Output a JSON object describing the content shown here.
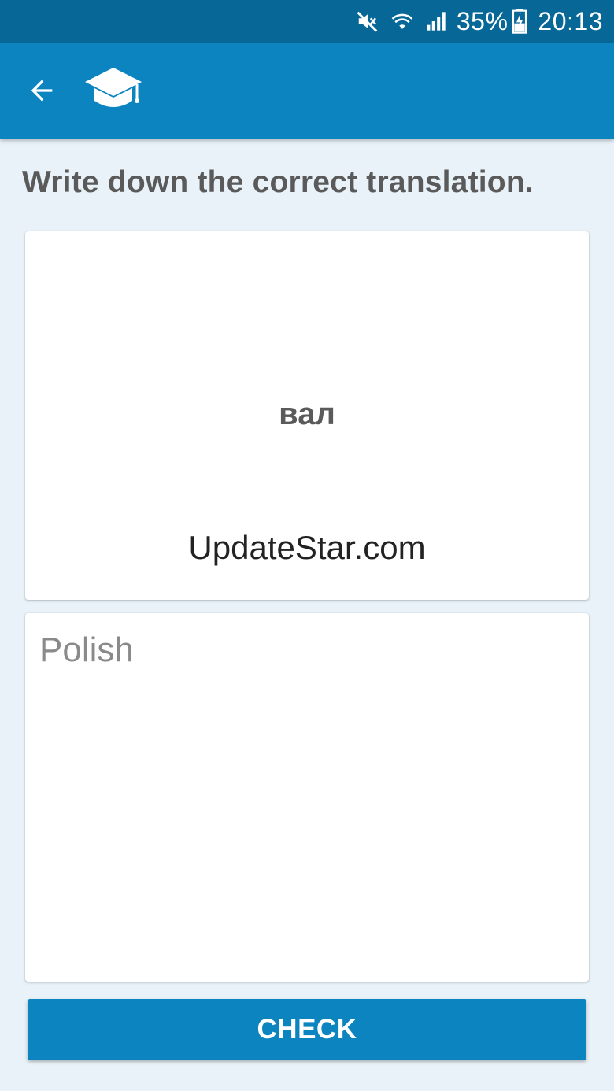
{
  "status_bar": {
    "battery_percent": "35%",
    "time": "20:13",
    "icons": [
      "mute-icon",
      "wifi-icon",
      "signal-icon",
      "battery-charging-icon"
    ]
  },
  "app_bar": {
    "icons": [
      "back-arrow-icon",
      "graduation-cap-icon"
    ],
    "color": "#0b84bf"
  },
  "exercise": {
    "instruction": "Write down the correct translation.",
    "word": "вал",
    "watermark": "UpdateStar.com",
    "answer_placeholder": "Polish",
    "answer_value": "",
    "check_label": "CHECK"
  }
}
